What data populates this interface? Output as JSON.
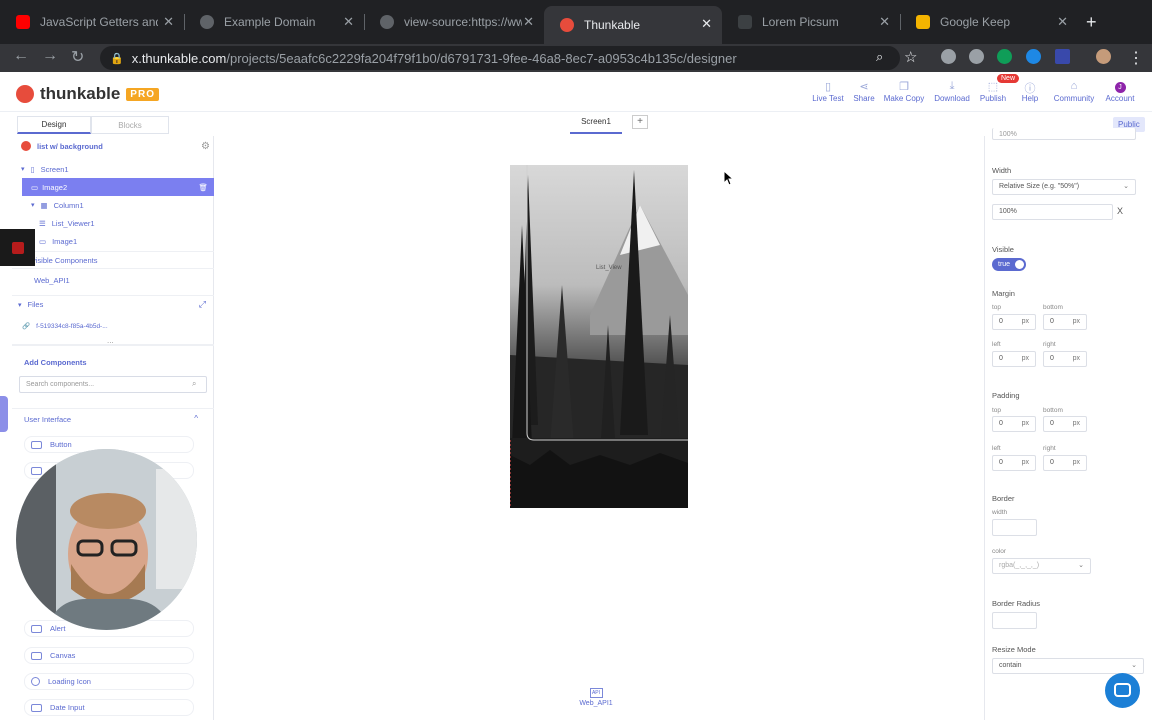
{
  "browser": {
    "tabs": [
      {
        "title": "JavaScript Getters and",
        "color": "#ff0000"
      },
      {
        "title": "Example Domain",
        "color": "#5f6368"
      },
      {
        "title": "view-source:https://ww",
        "color": "#5f6368"
      },
      {
        "title": "Thunkable",
        "color": "#e74c3c"
      },
      {
        "title": "Lorem Picsum",
        "color": "#3c4043"
      },
      {
        "title": "Google Keep",
        "color": "#f4b400"
      }
    ],
    "url_host": "x.thunkable.com",
    "url_path": "/projects/5eaafc6c2229fa204f79f1b0/d6791731-9fee-46a8-8ec7-a0953c4b135c/designer"
  },
  "app": {
    "brand": "thunkable",
    "plan": "PRO",
    "toolbar": [
      {
        "label": "Live Test",
        "icon": "phone-icon"
      },
      {
        "label": "Share",
        "icon": "share-icon"
      },
      {
        "label": "Make Copy",
        "icon": "copy-icon"
      },
      {
        "label": "Download",
        "icon": "download-icon"
      },
      {
        "label": "Publish",
        "icon": "publish-icon"
      },
      {
        "label": "Help",
        "icon": "help-icon"
      },
      {
        "label": "Community",
        "icon": "community-icon"
      },
      {
        "label": "Account",
        "icon": "account-icon"
      }
    ],
    "new_badge": "New",
    "account_initial": "J",
    "mode_tabs": {
      "design": "Design",
      "blocks": "Blocks"
    },
    "screen_tab": "Screen1",
    "add_screen": "+",
    "visibility": "Public"
  },
  "tree": {
    "project_name": "list w/ background",
    "items": [
      "Screen1",
      "Image2",
      "Column1",
      "List_Viewer1",
      "Image1"
    ],
    "invisible_header": "visible Components",
    "invisible_items": [
      "Web_API1"
    ],
    "files_header": "Files",
    "files": [
      "f-519334c8-f85a-4b5d-..."
    ],
    "more": "..."
  },
  "components": {
    "header": "Add Components",
    "search_placeholder": "Search components...",
    "category": "User Interface",
    "items": [
      "Button",
      "Alert",
      "Canvas",
      "Loading Icon",
      "Date Input"
    ]
  },
  "canvas": {
    "list_label": "List_View",
    "web_api_label": "Web_API1",
    "api_badge": "API"
  },
  "properties": {
    "top_value": "100%",
    "width_label": "Width",
    "width_mode": "Relative Size (e.g. \"50%\")",
    "width_value": "100%",
    "clear": "X",
    "visible_label": "Visible",
    "visible_value": "true",
    "margin_label": "Margin",
    "padding_label": "Padding",
    "top": "top",
    "bottom": "bottom",
    "left": "left",
    "right": "right",
    "zero": "0",
    "unit": "px",
    "border_label": "Border",
    "border_width": "width",
    "border_color": "color",
    "border_color_value": "rgba(_,_,_,_)",
    "radius_label": "Border Radius",
    "resize_label": "Resize Mode",
    "resize_value": "contain"
  }
}
